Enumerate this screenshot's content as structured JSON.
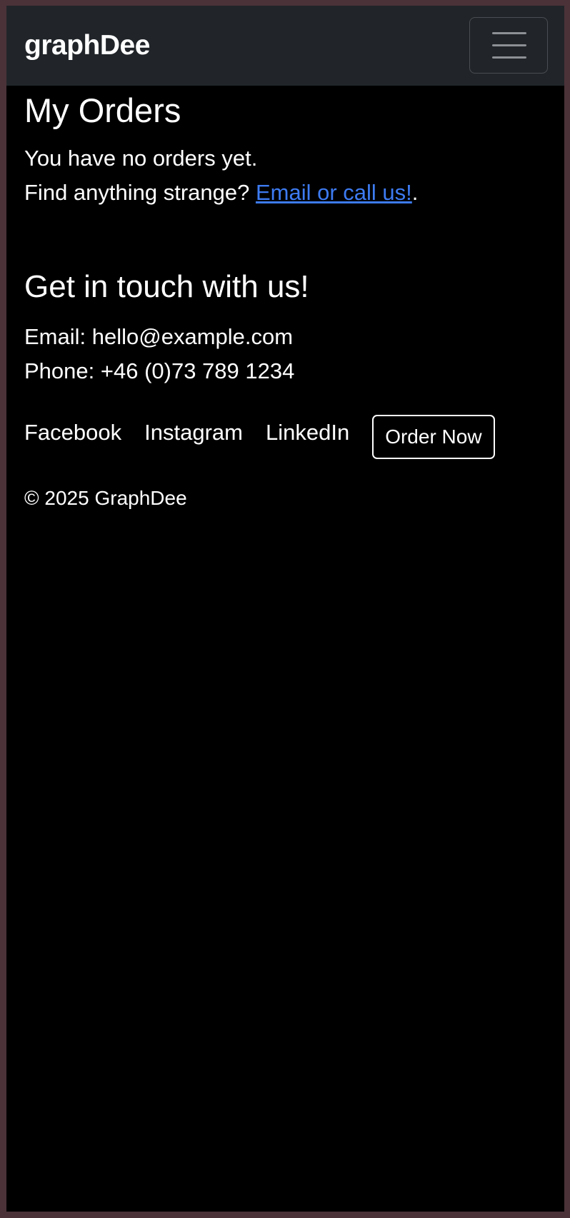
{
  "navbar": {
    "brand": "graphDee",
    "toggler_icon": "hamburger-menu-icon"
  },
  "main": {
    "title": "My Orders",
    "empty_message": "You have no orders yet.",
    "help_prefix": "Find anything strange? ",
    "help_link": "Email or call us!",
    "help_suffix": "."
  },
  "footer": {
    "title": "Get in touch with us!",
    "email": "Email: hello@example.com",
    "phone": "Phone: +46 (0)73 789 1234",
    "links": [
      "Facebook",
      "Instagram",
      "LinkedIn"
    ],
    "order_button": "Order Now",
    "copyright": "© 2025 GraphDee"
  },
  "colors": {
    "navbar_bg": "#212529",
    "page_bg": "#000000",
    "link": "#3d7bf2",
    "outer_border": "#4a3238"
  }
}
